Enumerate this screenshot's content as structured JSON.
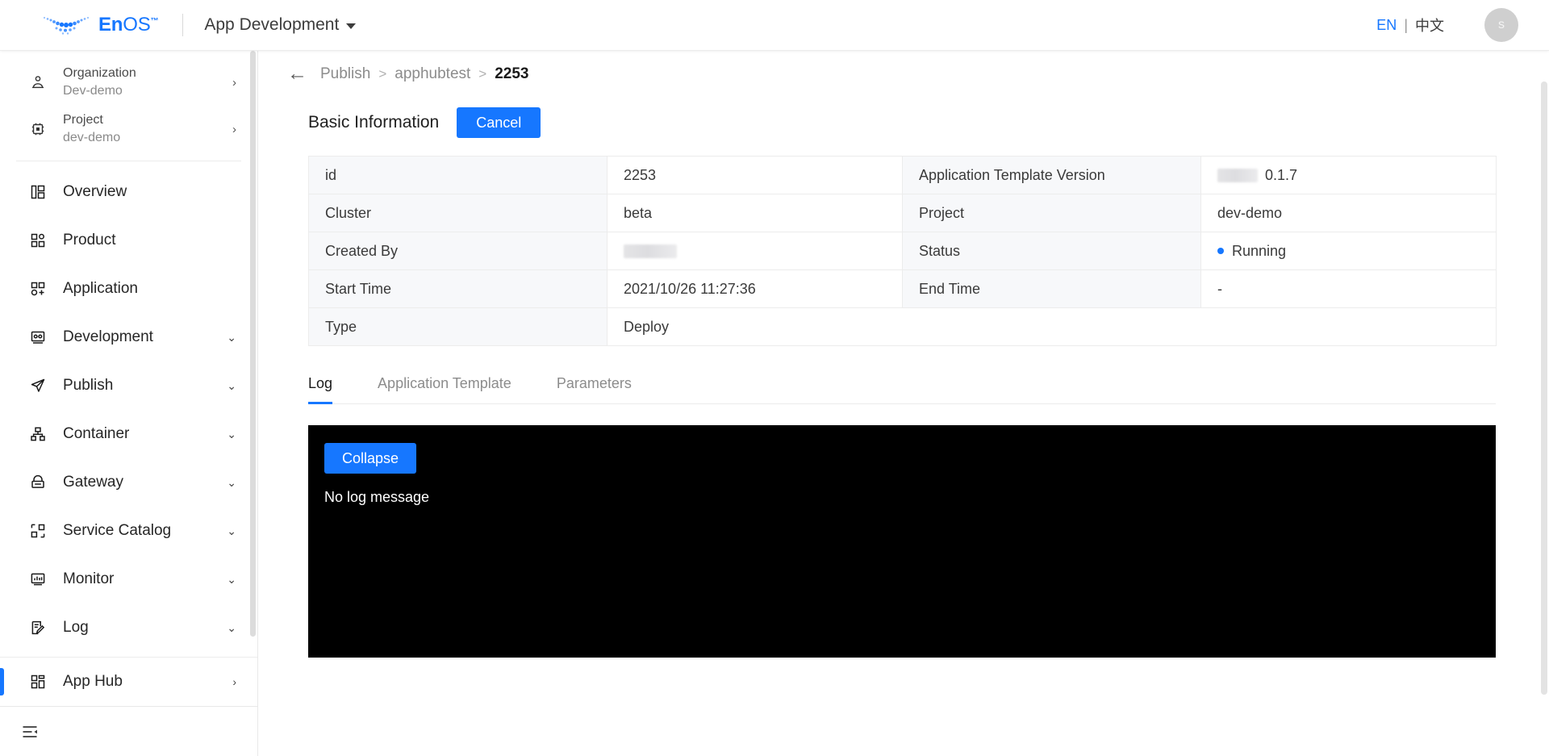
{
  "header": {
    "brand_name_en": "En",
    "brand_name_os": "OS",
    "brand_tm": "™",
    "app_switcher_label": "App Development",
    "lang_en": "EN",
    "lang_sep": "|",
    "lang_cn": "中文",
    "avatar_initial": "s"
  },
  "sidebar": {
    "context": [
      {
        "label": "Organization",
        "value": "Dev-demo",
        "icon": "organization-icon",
        "arrow": "›"
      },
      {
        "label": "Project",
        "value": "dev-demo",
        "icon": "project-icon",
        "arrow": "›"
      }
    ],
    "items": [
      {
        "label": "Overview",
        "icon": "overview-icon",
        "arrow": ""
      },
      {
        "label": "Product",
        "icon": "product-icon",
        "arrow": ""
      },
      {
        "label": "Application",
        "icon": "application-icon",
        "arrow": ""
      },
      {
        "label": "Development",
        "icon": "development-icon",
        "arrow": "⌄"
      },
      {
        "label": "Publish",
        "icon": "publish-icon",
        "arrow": "⌄"
      },
      {
        "label": "Container",
        "icon": "container-icon",
        "arrow": "⌄"
      },
      {
        "label": "Gateway",
        "icon": "gateway-icon",
        "arrow": "⌄"
      },
      {
        "label": "Service Catalog",
        "icon": "service-catalog-icon",
        "arrow": "⌄"
      },
      {
        "label": "Monitor",
        "icon": "monitor-icon",
        "arrow": "⌄"
      },
      {
        "label": "Log",
        "icon": "log-icon",
        "arrow": "⌄"
      }
    ],
    "active_item": {
      "label": "App Hub",
      "icon": "app-hub-icon",
      "arrow": "›"
    }
  },
  "breadcrumb": {
    "back": "←",
    "items": [
      "Publish",
      "apphubtest"
    ],
    "separator": ">",
    "current": "2253"
  },
  "section": {
    "title": "Basic Information",
    "cancel_label": "Cancel"
  },
  "info": {
    "rows": [
      {
        "k1": "id",
        "v1": "2253",
        "v1_redacted": false,
        "k2": "Application Template Version",
        "v2": "0.1.7",
        "v2_redacted": true,
        "v2_status": false
      },
      {
        "k1": "Cluster",
        "v1": "beta",
        "v1_redacted": false,
        "k2": "Project",
        "v2": "dev-demo",
        "v2_redacted": false,
        "v2_status": false
      },
      {
        "k1": "Created By",
        "v1": "",
        "v1_redacted": true,
        "k2": "Status",
        "v2": "Running",
        "v2_redacted": false,
        "v2_status": true
      },
      {
        "k1": "Start Time",
        "v1": "2021/10/26 11:27:36",
        "v1_redacted": false,
        "k2": "End Time",
        "v2": "-",
        "v2_redacted": false,
        "v2_status": false
      },
      {
        "k1": "Type",
        "v1": "Deploy",
        "v1_redacted": false,
        "k2": "",
        "v2": "",
        "v2_redacted": false,
        "v2_status": false
      }
    ]
  },
  "tabs": [
    {
      "label": "Log",
      "active": true
    },
    {
      "label": "Application Template",
      "active": false
    },
    {
      "label": "Parameters",
      "active": false
    }
  ],
  "console": {
    "collapse_label": "Collapse",
    "message": "No log message"
  },
  "colors": {
    "accent": "#1677ff",
    "status_running": "#1677ff",
    "console_bg": "#000000",
    "table_key_bg": "#f7f8fa",
    "border": "#ececec"
  }
}
